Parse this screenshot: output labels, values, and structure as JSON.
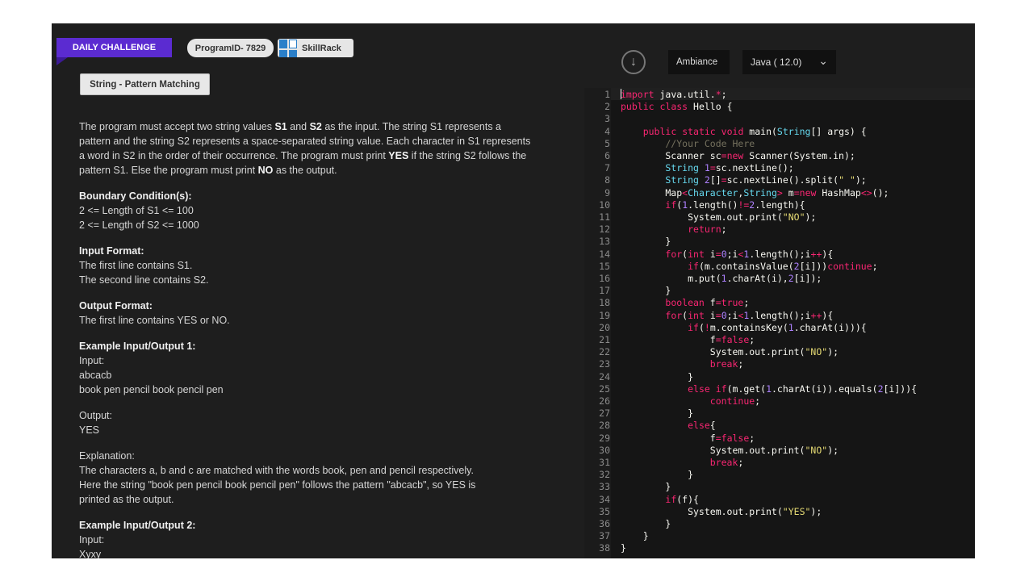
{
  "header": {
    "daily_challenge": "DAILY CHALLENGE",
    "program_id": "ProgramID- 7829",
    "brand": "SkillRack",
    "tag": "String - Pattern Matching"
  },
  "problem": {
    "description_parts": [
      "The program must accept two string values ",
      "S1",
      " and ",
      "S2",
      " as the input. The string S1 represents a pattern and the string S2 represents a space-separated string value. Each character in S1 represents a word in S2 in the order of their occurrence. The program must print ",
      "YES",
      " if the string S2 follows the pattern S1. Else the program must print ",
      "NO",
      " as the output."
    ],
    "boundary_title": "Boundary Condition(s):",
    "boundary_1": "2 <= Length of S1 <= 100",
    "boundary_2": "2 <= Length of S2 <= 1000",
    "input_format_title": "Input Format:",
    "input_format_1": "The first line contains S1.",
    "input_format_2": "The second line contains S2.",
    "output_format_title": "Output Format:",
    "output_format_1": "The first line contains YES or NO.",
    "example1_title": "Example Input/Output 1:",
    "example1_input_label": "Input:",
    "example1_input_1": "abcacb",
    "example1_input_2": "book pen pencil book pencil pen",
    "example1_output_label": "Output:",
    "example1_output": "YES",
    "explanation_label": "Explanation:",
    "explanation_1": "The characters a, b and c are matched with the words book, pen and pencil respectively.",
    "explanation_2": "Here the string \"book pen pencil book pencil pen\" follows the pattern \"abcacb\", so YES is",
    "explanation_3": "printed as the output.",
    "example2_title": "Example Input/Output 2:",
    "example2_input_label": "Input:",
    "example2_input_1": "Xyxy"
  },
  "editor": {
    "theme": "Ambiance",
    "language": "Java ( 12.0)"
  },
  "code_lines": [
    "import java.util.*;",
    "public class Hello {",
    "",
    "    public static void main(String[] args) {",
    "        //Your Code Here",
    "        Scanner sc=new Scanner(System.in);",
    "        String S1=sc.nextLine();",
    "        String S2[]=sc.nextLine().split(\" \");",
    "        Map<Character,String> m=new HashMap<>();",
    "        if(S1.length()!=S2.length){",
    "            System.out.print(\"NO\");",
    "            return;",
    "        }",
    "        for(int i=0;i<S1.length();i++){",
    "            if(m.containsValue(S2[i]))continue;",
    "            m.put(S1.charAt(i),S2[i]);",
    "        }",
    "        boolean f=true;",
    "        for(int i=0;i<S1.length();i++){",
    "            if(!m.containsKey(S1.charAt(i))){",
    "                f=false;",
    "                System.out.print(\"NO\");",
    "                break;",
    "            }",
    "            else if(m.get(S1.charAt(i)).equals(S2[i])){",
    "                continue;",
    "            }",
    "            else{",
    "                f=false;",
    "                System.out.print(\"NO\");",
    "                break;",
    "            }",
    "        }",
    "        if(f){",
    "            System.out.print(\"YES\");",
    "        }",
    "    }",
    "}"
  ]
}
